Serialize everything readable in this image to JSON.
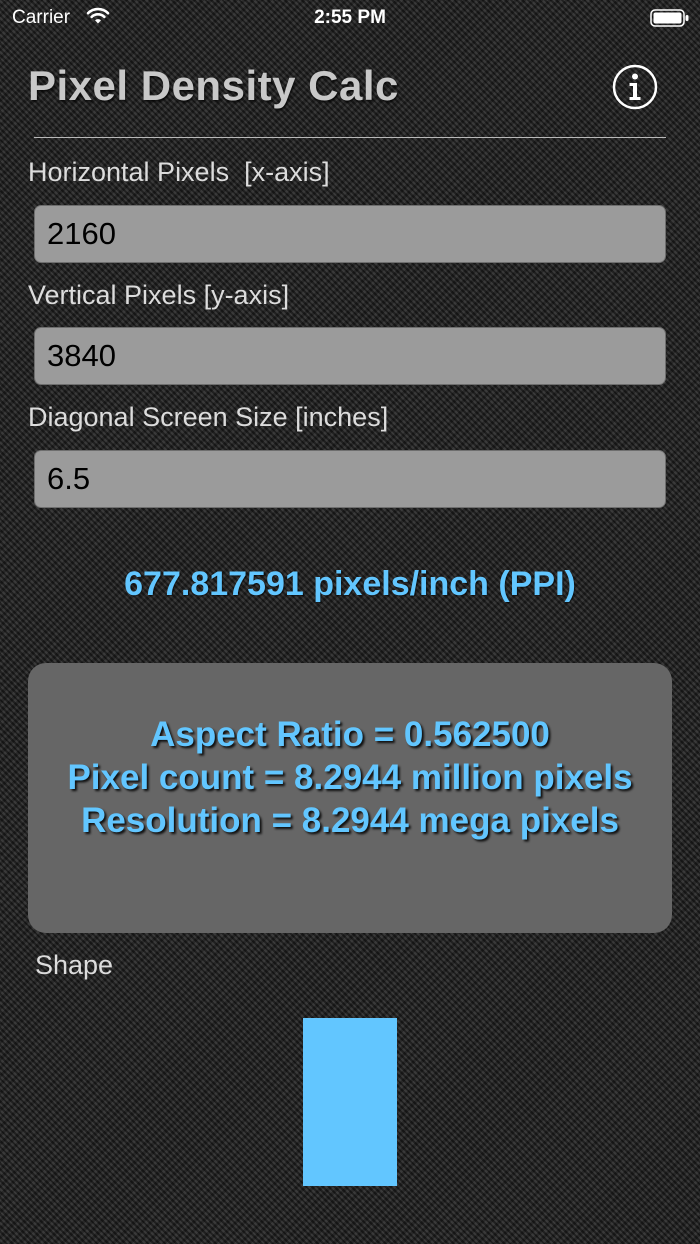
{
  "status_bar": {
    "carrier": "Carrier",
    "time": "2:55 PM"
  },
  "header": {
    "title": "Pixel Density Calc",
    "info_icon": "info-icon"
  },
  "fields": {
    "horizontal": {
      "label": "Horizontal Pixels  [x-axis]",
      "value": "2160"
    },
    "vertical": {
      "label": "Vertical Pixels [y-axis]",
      "value": "3840"
    },
    "diagonal": {
      "label": "Diagonal Screen Size [inches]",
      "value": "6.5"
    }
  },
  "result": {
    "ppi": "677.817591 pixels/inch (PPI)"
  },
  "panel": {
    "aspect_ratio": "Aspect Ratio = 0.562500",
    "pixel_count": "Pixel count = 8.2944 million pixels",
    "resolution": "Resolution = 8.2944 mega pixels"
  },
  "shape": {
    "label": "Shape",
    "color": "#62c6ff"
  },
  "colors": {
    "accent": "#62c6ff",
    "panel_bg": "#666666",
    "input_bg": "#9b9b9b"
  }
}
